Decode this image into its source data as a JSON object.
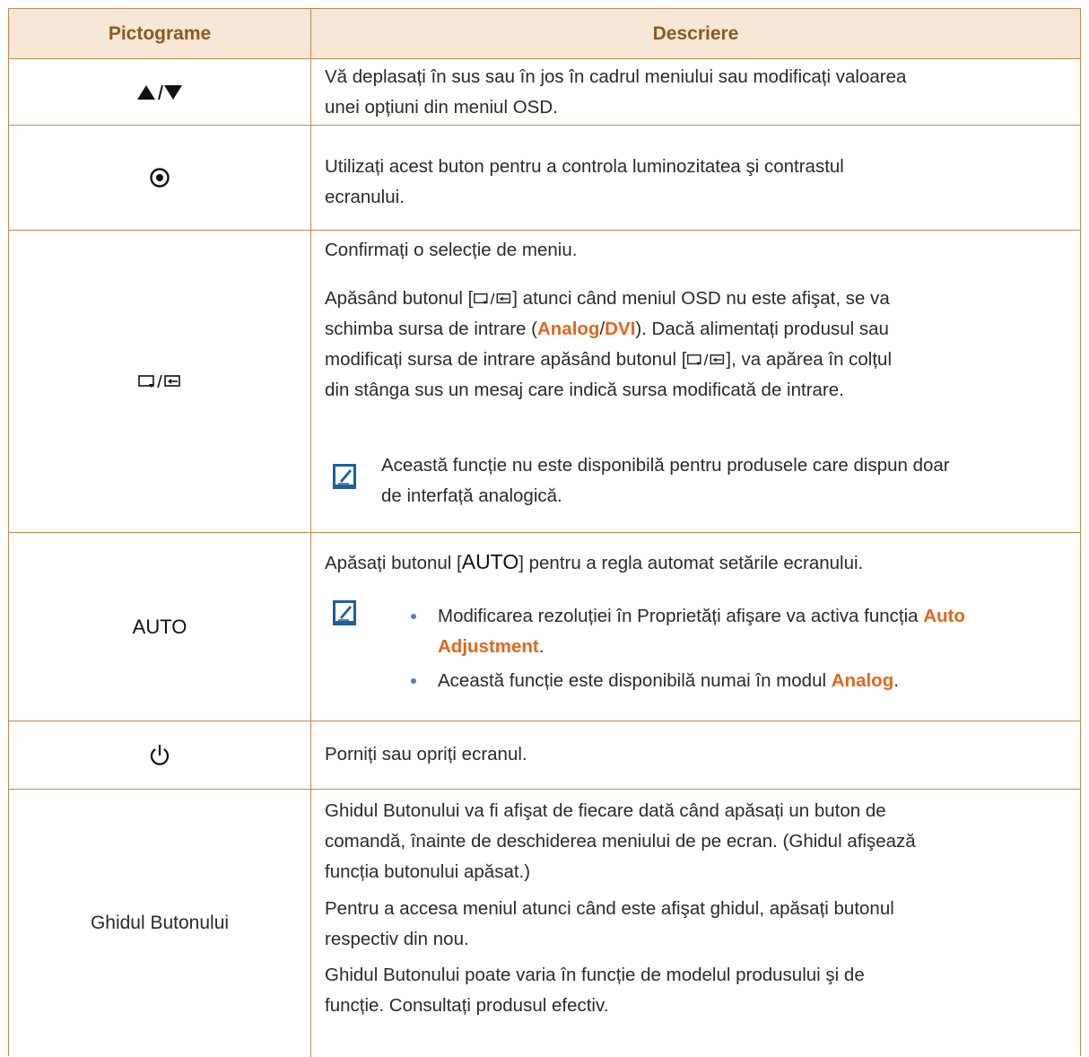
{
  "header": {
    "col1": "Pictograme",
    "col2": "Descriere"
  },
  "rows": {
    "updown": {
      "icon_name": "up-down-arrows-icon",
      "desc_line1": "Vă deplasați în sus sau în jos în cadrul meniului sau modificați valoarea",
      "desc_line2": "unei opțiuni din meniul OSD."
    },
    "brightness": {
      "icon_name": "brightness-icon",
      "desc_line1": "Utilizați acest buton pentru a controla luminozitatea şi contrastul",
      "desc_line2": "ecranului."
    },
    "source": {
      "icon_name": "source-enter-icon",
      "p1": "Confirmați o selecție de meniu.",
      "p2_a": "Apăsând butonul [",
      "p2_b": "] atunci când meniul OSD nu este afişat, se va",
      "p2_c": "schimba sursa de intrare (",
      "p2_analog": "Analog",
      "p2_slash": "/",
      "p2_dvi": "DVI",
      "p2_d": "). Dacă alimentați produsul sau",
      "p2_e": "modificați sursa de intrare apăsând butonul [",
      "p2_f": "], va apărea în colțul",
      "p2_g": "din stânga sus un mesaj care indică sursa modificată de intrare.",
      "note_line1": "Această funcție nu este disponibilă pentru produsele care dispun doar",
      "note_line2": "de interfață analogică."
    },
    "auto": {
      "label": "AUTO",
      "p1_a": "Apăsați butonul [",
      "p1_auto": "AUTO",
      "p1_b": "] pentru a regla automat setările ecranului.",
      "b1_a": "Modificarea rezoluției în Proprietăți afişare va activa funcția",
      "b1_hl1": "Auto",
      "b1_hl2": "Adjustment",
      "b1_end": ".",
      "b2_a": "Această funcție este disponibilă numai în modul",
      "b2_hl": "Analog",
      "b2_end": "."
    },
    "power": {
      "icon_name": "power-icon",
      "desc": "Porniți sau opriți ecranul."
    },
    "guide": {
      "label": "Ghidul Butonului",
      "p1_l1": "Ghidul Butonului va fi afişat de fiecare dată când apăsați un buton de",
      "p1_l2": "comandă, înainte de deschiderea meniului de pe ecran. (Ghidul afişează",
      "p1_l3": "funcția butonului apăsat.)",
      "p2_l1": "Pentru a accesa meniul atunci când este afişat ghidul, apăsați butonul",
      "p2_l2": "respectiv din nou.",
      "p3_l1": "Ghidul Butonului poate varia în funcție de modelul produsului şi de",
      "p3_l2": "funcție. Consultați produsul efectiv."
    }
  },
  "colors": {
    "border": "#c08a4e",
    "header_bg": "#f6e7d6",
    "header_text": "#8a5a1f",
    "highlight": "#e2661d",
    "note_icon": "#1e5f9e"
  }
}
